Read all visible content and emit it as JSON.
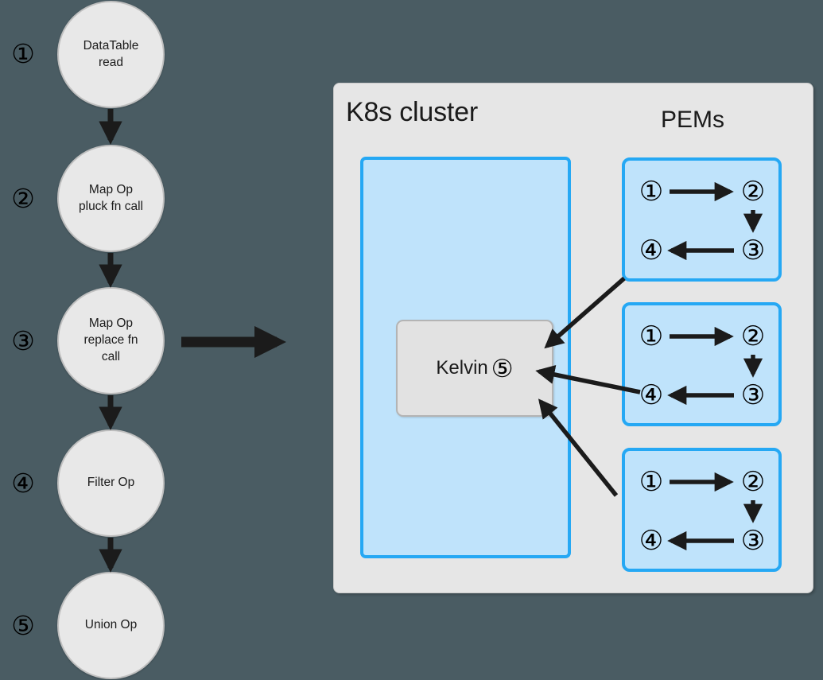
{
  "background_color": "#4a5c63",
  "pipeline": {
    "name": "execution-plan-steps",
    "nodes": [
      {
        "step": "①",
        "label": "DataTable read",
        "lines": [
          "DataTable",
          "read"
        ]
      },
      {
        "step": "②",
        "label": "Map Op pluck fn call",
        "lines": [
          "Map Op",
          "pluck fn call"
        ]
      },
      {
        "step": "③",
        "label": "Map Op replace fn call",
        "lines": [
          "Map Op",
          "replace fn",
          "call"
        ]
      },
      {
        "step": "④",
        "label": "Filter Op",
        "lines": [
          "Filter Op"
        ]
      },
      {
        "step": "⑤",
        "label": "Union Op",
        "lines": [
          "Union Op"
        ]
      }
    ],
    "node_fill": "#e8e8e8",
    "node_stroke": "#bfbfbf",
    "arrow_color": "#1b1b1b"
  },
  "transition_arrow": {
    "name": "compiles-to-arrow",
    "color": "#1b1b1b"
  },
  "cluster": {
    "title": "K8s cluster",
    "panel_fill": "#e6e6e6",
    "panel_stroke": "#c9c9c9",
    "vizier": {
      "fill": "#bfe3fb",
      "stroke": "#25a8f4"
    },
    "kelvin": {
      "label": "Kelvin",
      "badge": "⑤",
      "fill": "#e2e2e2",
      "stroke": "#b4b4b4"
    }
  },
  "pems": {
    "title": "PEMs",
    "fill": "#bfe3fb",
    "stroke": "#25a8f4",
    "arrow_color": "#1b1b1b",
    "boxes": [
      {
        "name": "pem-1",
        "nodes": [
          "①",
          "②",
          "③",
          "④"
        ]
      },
      {
        "name": "pem-2",
        "nodes": [
          "①",
          "②",
          "③",
          "④"
        ]
      },
      {
        "name": "pem-3",
        "nodes": [
          "①",
          "②",
          "③",
          "④"
        ]
      }
    ]
  }
}
